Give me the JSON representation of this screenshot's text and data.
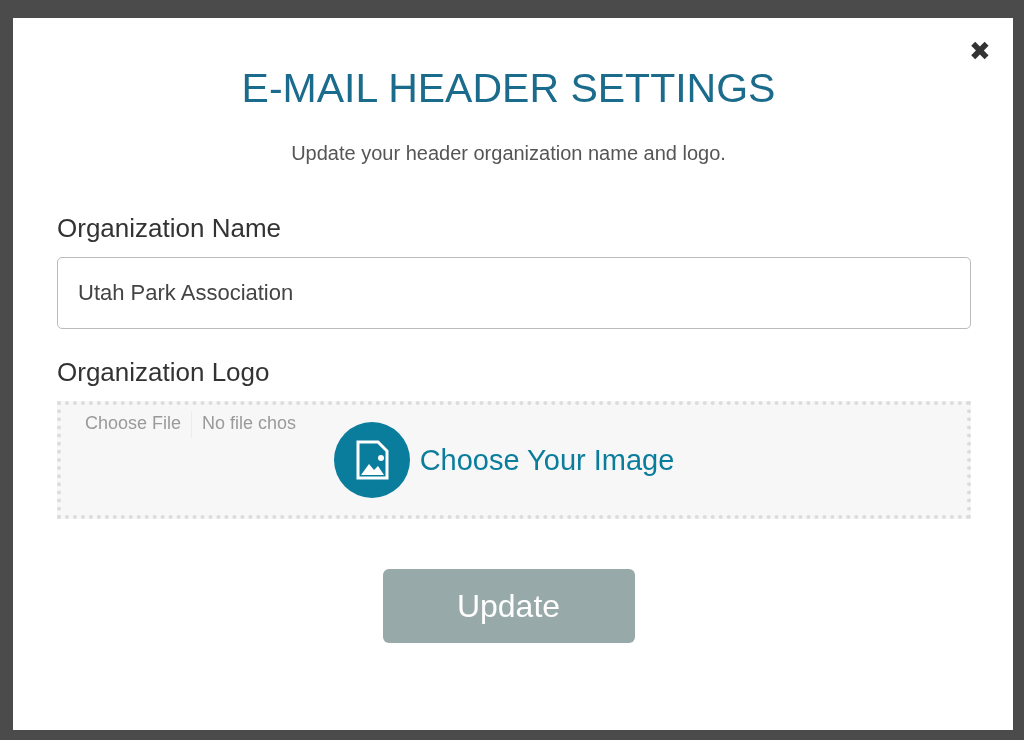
{
  "dialog": {
    "title": "E-MAIL HEADER SETTINGS",
    "subtitle": "Update your header organization name and logo.",
    "close": "✖"
  },
  "name_field": {
    "label": "Organization Name",
    "value": "Utah Park Association"
  },
  "logo_field": {
    "label": "Organization Logo",
    "file_button": "Choose File",
    "file_status": "No file chos",
    "drop_label": "Choose Your Image"
  },
  "submit": {
    "label": "Update",
    "disabled": true
  }
}
